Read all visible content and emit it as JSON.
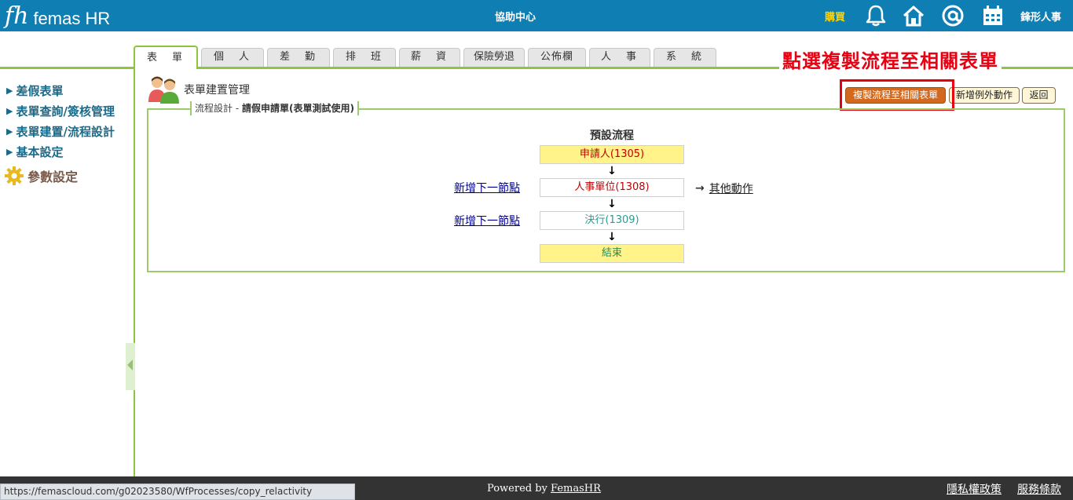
{
  "header": {
    "logo_mark": "fh",
    "logo_text": "femas HR",
    "help_center": "協助中心",
    "buy": "購買",
    "company": "鋒形人事",
    "icons": [
      "bell-icon",
      "home-icon",
      "at-icon",
      "calendar-icon"
    ]
  },
  "tabs": [
    {
      "label": "表　單",
      "active": true
    },
    {
      "label": "個　人"
    },
    {
      "label": "差　勤"
    },
    {
      "label": "排　班"
    },
    {
      "label": "薪　資"
    },
    {
      "label": "保險勞退"
    },
    {
      "label": "公佈欄"
    },
    {
      "label": "人　事"
    },
    {
      "label": "系　統"
    }
  ],
  "banner": "點選複製流程至相關表單",
  "sidebar": {
    "items": [
      "差假表單",
      "表單查詢/簽核管理",
      "表單建置/流程設計",
      "基本設定"
    ],
    "param": "參數設定"
  },
  "page": {
    "title": "表單建置管理",
    "buttons": {
      "copy": "複製流程至相關表單",
      "add_exception": "新增例外動作",
      "back": "返回"
    },
    "legend_prefix": "流程設計 - ",
    "legend_form": "請假申請單(表單測試使用)"
  },
  "flow": {
    "title": "預設流程",
    "nodes": [
      {
        "label": "申請人(1305)",
        "color": "#c00000"
      },
      {
        "label": "人事單位(1308)",
        "color": "#c00000"
      },
      {
        "label": "決行(1309)",
        "color": "#2a9d8f"
      },
      {
        "label": "結束",
        "color": "#2e8b57"
      }
    ],
    "add_next": "新增下一節點",
    "other_action": "其他動作"
  },
  "footer": {
    "status_url": "https://femascloud.com/g02023580/WfProcesses/copy_relactivity",
    "powered_prefix": "Powered by ",
    "powered_link": "FemasHR",
    "privacy": "隱私權政策",
    "terms": "服務條款"
  },
  "colors": {
    "topbar": "#0f7fb3",
    "accent_green": "#8cc63f",
    "banner_red": "#e60012"
  }
}
